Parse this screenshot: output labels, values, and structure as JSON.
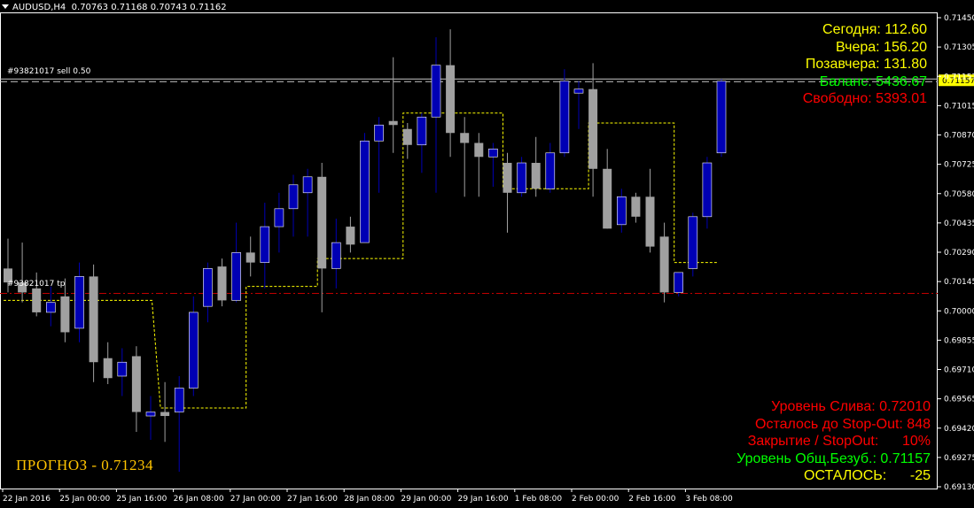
{
  "header": {
    "symbol": "AUDUSD,H4",
    "ohlc": "0.70763 0.71168 0.70743 0.71162"
  },
  "order_labels": {
    "sell": "#93821017 sell 0.50",
    "tp": "#93821017 tp"
  },
  "price_axis": {
    "ticks": [
      "0.71450",
      "0.71305",
      "0.71157",
      "0.71015",
      "0.70870",
      "0.70725",
      "0.70580",
      "0.70435",
      "0.70290",
      "0.70145",
      "0.70000",
      "0.69855",
      "0.69710",
      "0.69565",
      "0.69420",
      "0.69275",
      "0.69130"
    ],
    "current_price": "0.71157"
  },
  "time_axis": {
    "labels": [
      "22 Jan 2016",
      "25 Jan 00:00",
      "25 Jan 16:00",
      "26 Jan 08:00",
      "27 Jan 00:00",
      "27 Jan 16:00",
      "28 Jan 08:00",
      "29 Jan 00:00",
      "29 Jan 16:00",
      "1 Feb 08:00",
      "2 Feb 00:00",
      "2 Feb 16:00",
      "3 Feb 08:00"
    ]
  },
  "info_top": [
    {
      "label": "Сегодня:",
      "value": "112.60",
      "color": "#ffff00"
    },
    {
      "label": "Вчера:",
      "value": "156.20",
      "color": "#ffff00"
    },
    {
      "label": "Позавчера:",
      "value": "131.80",
      "color": "#ffff00"
    },
    {
      "label": "Баланс:",
      "value": "5436.67",
      "color": "#00ff00"
    },
    {
      "label": "Свободно:",
      "value": "5393.01",
      "color": "#ff0000"
    }
  ],
  "info_bottom": [
    {
      "text": "Уровень Слива: 0.72010",
      "color": "#ff0000"
    },
    {
      "text": "Осталось до Stop-Out: 848",
      "color": "#ff0000"
    },
    {
      "text": "Закрытие / StopOut:      10%",
      "color": "#ff0000"
    },
    {
      "text": "Уровень Общ.Безуб.: 0.71157",
      "color": "#00ff00"
    },
    {
      "text": "ОСТАЛОСЬ:      -25",
      "color": "#ffff00"
    }
  ],
  "forecast": {
    "text": "ПРОГНОЗ - 0.71234",
    "color": "#ffc400"
  },
  "colors": {
    "bull": "#0000b4",
    "bear": "#a0a0a0",
    "trail": "#ffff00",
    "tp_line": "#c00000",
    "sell_line": "#c8c8c8",
    "price_tag": "#ffff00"
  },
  "chart_data": {
    "type": "candlestick",
    "ylim": [
      0.6913,
      0.7152
    ],
    "sell_level": 0.71162,
    "tp_level": 0.70095,
    "candles": [
      {
        "o": 0.7022,
        "h": 0.7037,
        "l": 0.701,
        "c": 0.7015
      },
      {
        "o": 0.7015,
        "h": 0.7035,
        "l": 0.7005,
        "c": 0.701
      },
      {
        "o": 0.7012,
        "h": 0.702,
        "l": 0.6998,
        "c": 0.7
      },
      {
        "o": 0.7,
        "h": 0.7013,
        "l": 0.6993,
        "c": 0.7005
      },
      {
        "o": 0.7008,
        "h": 0.7017,
        "l": 0.6985,
        "c": 0.699
      },
      {
        "o": 0.6992,
        "h": 0.7025,
        "l": 0.6985,
        "c": 0.7018
      },
      {
        "o": 0.7018,
        "h": 0.7024,
        "l": 0.6965,
        "c": 0.6975
      },
      {
        "o": 0.6977,
        "h": 0.6985,
        "l": 0.6964,
        "c": 0.6967
      },
      {
        "o": 0.6968,
        "h": 0.6982,
        "l": 0.6958,
        "c": 0.6975
      },
      {
        "o": 0.6978,
        "h": 0.6983,
        "l": 0.694,
        "c": 0.695
      },
      {
        "o": 0.6948,
        "h": 0.6958,
        "l": 0.6936,
        "c": 0.695
      },
      {
        "o": 0.695,
        "h": 0.6965,
        "l": 0.6935,
        "c": 0.6948
      },
      {
        "o": 0.695,
        "h": 0.6968,
        "l": 0.692,
        "c": 0.6962
      },
      {
        "o": 0.6962,
        "h": 0.7008,
        "l": 0.6958,
        "c": 0.7
      },
      {
        "o": 0.7003,
        "h": 0.7025,
        "l": 0.6995,
        "c": 0.7022
      },
      {
        "o": 0.7023,
        "h": 0.7027,
        "l": 0.7003,
        "c": 0.7006
      },
      {
        "o": 0.7006,
        "h": 0.7045,
        "l": 0.7005,
        "c": 0.703
      },
      {
        "o": 0.703,
        "h": 0.7038,
        "l": 0.7018,
        "c": 0.7025
      },
      {
        "o": 0.7025,
        "h": 0.7055,
        "l": 0.7012,
        "c": 0.7043
      },
      {
        "o": 0.7043,
        "h": 0.706,
        "l": 0.703,
        "c": 0.7052
      },
      {
        "o": 0.7052,
        "h": 0.7069,
        "l": 0.7038,
        "c": 0.7064
      },
      {
        "o": 0.706,
        "h": 0.7072,
        "l": 0.7038,
        "c": 0.7068
      },
      {
        "o": 0.7068,
        "h": 0.7075,
        "l": 0.7,
        "c": 0.7022
      },
      {
        "o": 0.7022,
        "h": 0.7047,
        "l": 0.7012,
        "c": 0.7035
      },
      {
        "o": 0.7043,
        "h": 0.7048,
        "l": 0.703,
        "c": 0.7034
      },
      {
        "o": 0.7035,
        "h": 0.709,
        "l": 0.7035,
        "c": 0.7086
      },
      {
        "o": 0.7086,
        "h": 0.7098,
        "l": 0.706,
        "c": 0.7094
      },
      {
        "o": 0.7096,
        "h": 0.7128,
        "l": 0.708,
        "c": 0.7094
      },
      {
        "o": 0.7092,
        "h": 0.7095,
        "l": 0.7077,
        "c": 0.7084
      },
      {
        "o": 0.7084,
        "h": 0.71,
        "l": 0.707,
        "c": 0.7098
      },
      {
        "o": 0.7098,
        "h": 0.7138,
        "l": 0.706,
        "c": 0.7124
      },
      {
        "o": 0.7124,
        "h": 0.7142,
        "l": 0.7078,
        "c": 0.709
      },
      {
        "o": 0.709,
        "h": 0.7098,
        "l": 0.7058,
        "c": 0.7085
      },
      {
        "o": 0.7085,
        "h": 0.709,
        "l": 0.7058,
        "c": 0.7078
      },
      {
        "o": 0.7078,
        "h": 0.7085,
        "l": 0.7063,
        "c": 0.7082
      },
      {
        "o": 0.7075,
        "h": 0.708,
        "l": 0.704,
        "c": 0.706
      },
      {
        "o": 0.706,
        "h": 0.7078,
        "l": 0.7058,
        "c": 0.7075
      },
      {
        "o": 0.7075,
        "h": 0.7088,
        "l": 0.7058,
        "c": 0.7062
      },
      {
        "o": 0.7062,
        "h": 0.7085,
        "l": 0.706,
        "c": 0.708
      },
      {
        "o": 0.708,
        "h": 0.7122,
        "l": 0.7078,
        "c": 0.7116
      },
      {
        "o": 0.711,
        "h": 0.7116,
        "l": 0.7092,
        "c": 0.7112
      },
      {
        "o": 0.7112,
        "h": 0.7125,
        "l": 0.7058,
        "c": 0.7072
      },
      {
        "o": 0.7072,
        "h": 0.7082,
        "l": 0.7042,
        "c": 0.7042
      },
      {
        "o": 0.7044,
        "h": 0.7062,
        "l": 0.704,
        "c": 0.7058
      },
      {
        "o": 0.7058,
        "h": 0.706,
        "l": 0.7045,
        "c": 0.7048
      },
      {
        "o": 0.7058,
        "h": 0.7072,
        "l": 0.703,
        "c": 0.7033
      },
      {
        "o": 0.7038,
        "h": 0.7045,
        "l": 0.7005,
        "c": 0.701
      },
      {
        "o": 0.701,
        "h": 0.702,
        "l": 0.7008,
        "c": 0.702
      },
      {
        "o": 0.7022,
        "h": 0.705,
        "l": 0.7018,
        "c": 0.7048
      },
      {
        "o": 0.7048,
        "h": 0.7078,
        "l": 0.7042,
        "c": 0.7075
      },
      {
        "o": 0.708,
        "h": 0.7117,
        "l": 0.7078,
        "c": 0.7116
      }
    ],
    "trailing_stop": [
      {
        "from": 0,
        "to": 11,
        "y": 0.7006,
        "yEnd": 0.6952
      },
      {
        "from": 11,
        "to": 17,
        "y": 0.6952
      },
      {
        "from": 17,
        "to": 22,
        "y": 0.7013
      },
      {
        "from": 22,
        "to": 28,
        "y": 0.7027
      },
      {
        "from": 28,
        "to": 35,
        "y": 0.71
      },
      {
        "from": 35,
        "to": 41,
        "y": 0.7062
      },
      {
        "from": 41,
        "to": 47,
        "y": 0.7095
      },
      {
        "from": 47,
        "to": 50,
        "y": 0.7025
      }
    ]
  }
}
